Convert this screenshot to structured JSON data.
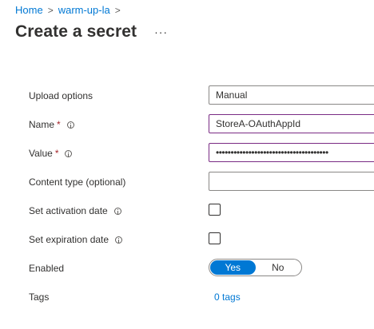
{
  "breadcrumb": {
    "items": [
      "Home",
      "warm-up-la"
    ],
    "separator": ">"
  },
  "page": {
    "title": "Create a secret",
    "more_label": "···"
  },
  "form": {
    "upload_options": {
      "label": "Upload options",
      "value": "Manual"
    },
    "name": {
      "label": "Name",
      "required": "*",
      "value": "StoreA-OAuthAppId"
    },
    "value": {
      "label": "Value",
      "required": "*",
      "value": "••••••••••••••••••••••••••••••••••••••"
    },
    "content_type": {
      "label": "Content type (optional)",
      "value": ""
    },
    "activation": {
      "label": "Set activation date",
      "checked": false
    },
    "expiration": {
      "label": "Set expiration date",
      "checked": false
    },
    "enabled": {
      "label": "Enabled",
      "yes": "Yes",
      "no": "No",
      "selected": "Yes"
    },
    "tags": {
      "label": "Tags",
      "link": "0 tags"
    }
  },
  "colors": {
    "accent": "#0078d4",
    "required": "#a4262c",
    "focus_border": "#7a2b84"
  }
}
